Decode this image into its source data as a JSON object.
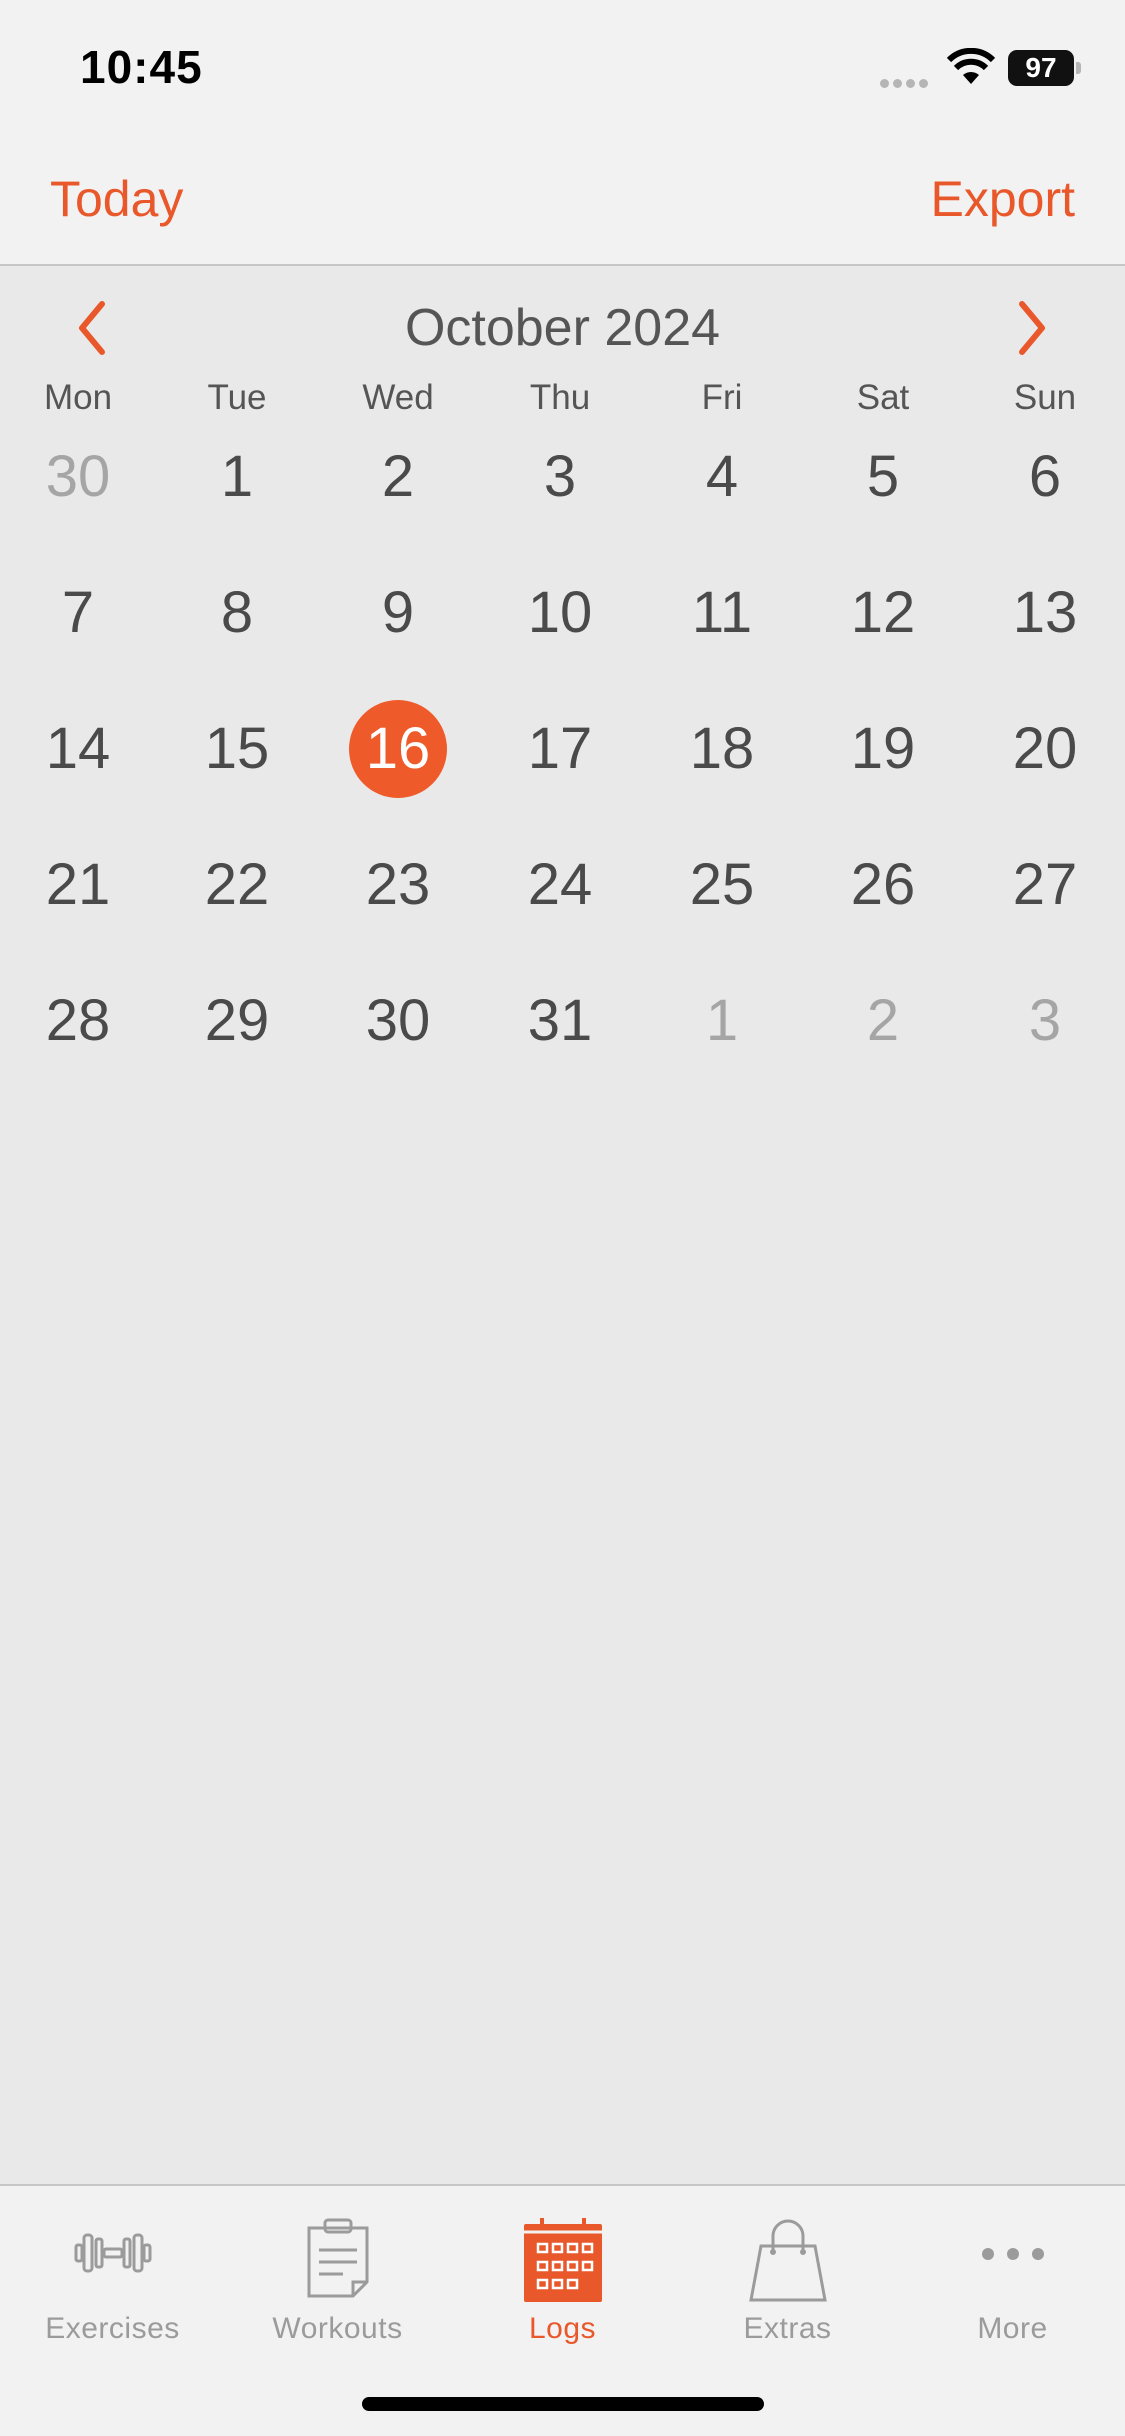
{
  "status": {
    "time": "10:45",
    "battery": "97"
  },
  "nav": {
    "left_label": "Today",
    "right_label": "Export"
  },
  "calendar": {
    "month_title": "October 2024",
    "weekdays": [
      "Mon",
      "Tue",
      "Wed",
      "Thu",
      "Fri",
      "Sat",
      "Sun"
    ],
    "weeks": [
      [
        {
          "d": "30",
          "other": true
        },
        {
          "d": "1"
        },
        {
          "d": "2"
        },
        {
          "d": "3"
        },
        {
          "d": "4"
        },
        {
          "d": "5"
        },
        {
          "d": "6"
        }
      ],
      [
        {
          "d": "7"
        },
        {
          "d": "8"
        },
        {
          "d": "9"
        },
        {
          "d": "10"
        },
        {
          "d": "11"
        },
        {
          "d": "12"
        },
        {
          "d": "13"
        }
      ],
      [
        {
          "d": "14"
        },
        {
          "d": "15"
        },
        {
          "d": "16",
          "selected": true
        },
        {
          "d": "17"
        },
        {
          "d": "18"
        },
        {
          "d": "19"
        },
        {
          "d": "20"
        }
      ],
      [
        {
          "d": "21"
        },
        {
          "d": "22"
        },
        {
          "d": "23"
        },
        {
          "d": "24"
        },
        {
          "d": "25"
        },
        {
          "d": "26"
        },
        {
          "d": "27"
        }
      ],
      [
        {
          "d": "28"
        },
        {
          "d": "29"
        },
        {
          "d": "30"
        },
        {
          "d": "31"
        },
        {
          "d": "1",
          "other": true
        },
        {
          "d": "2",
          "other": true
        },
        {
          "d": "3",
          "other": true
        }
      ]
    ]
  },
  "tabs": [
    {
      "label": "Exercises",
      "icon": "dumbbell-icon",
      "active": false
    },
    {
      "label": "Workouts",
      "icon": "clipboard-icon",
      "active": false
    },
    {
      "label": "Logs",
      "icon": "calendar-icon",
      "active": true
    },
    {
      "label": "Extras",
      "icon": "shopping-bag-icon",
      "active": false
    },
    {
      "label": "More",
      "icon": "more-icon",
      "active": false
    }
  ],
  "colors": {
    "accent": "#e8582a",
    "selected_day": "#ee5a29",
    "inactive_tab": "#9b9b9b"
  }
}
